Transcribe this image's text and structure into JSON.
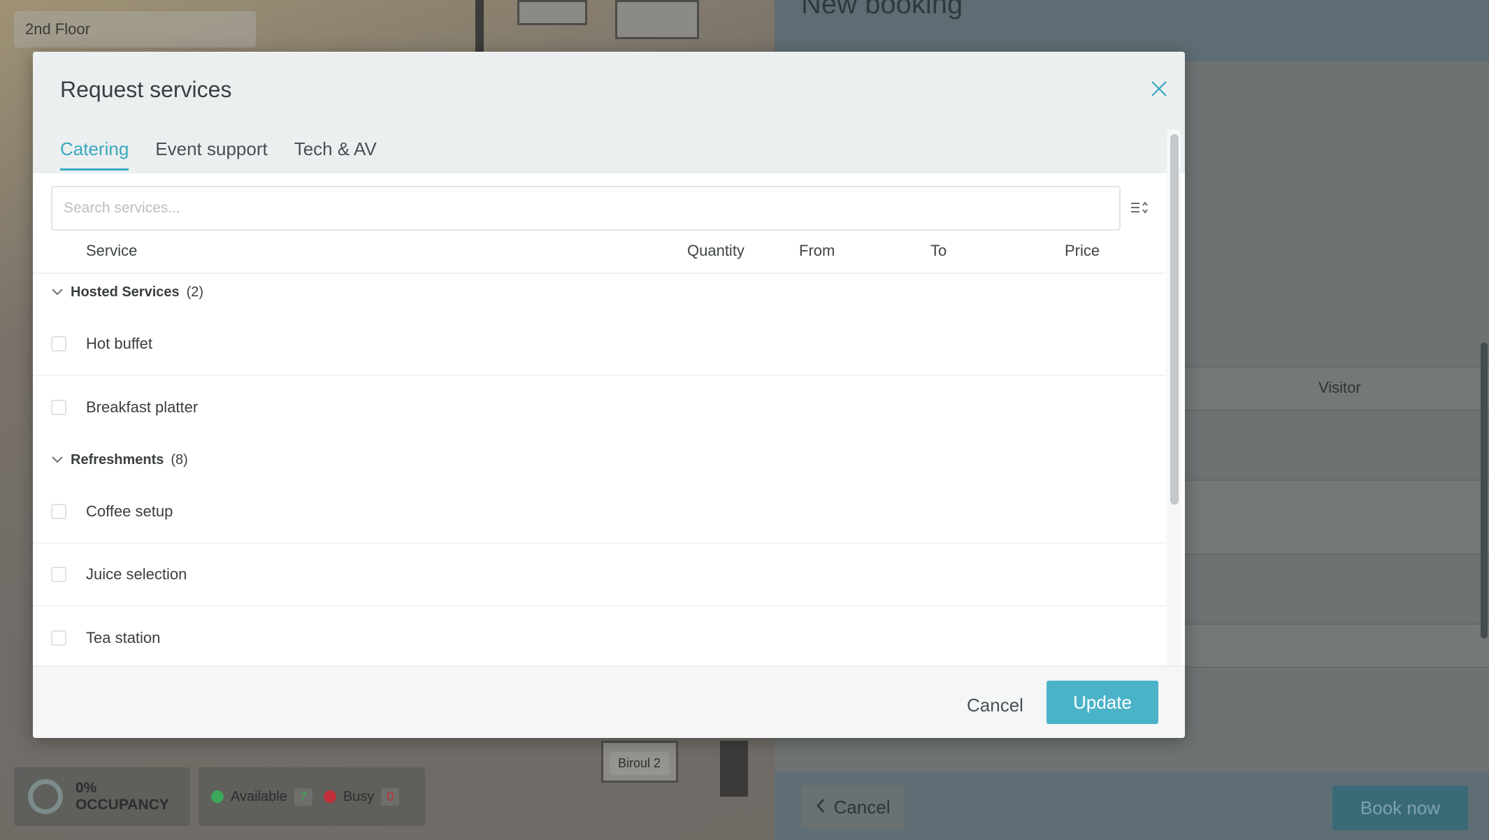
{
  "background": {
    "floor_select": "2nd Floor",
    "floor_tag": "Biroul 2",
    "occupancy": {
      "percent": "0%",
      "label": "OCCUPANCY"
    },
    "status": {
      "available_label": "Available",
      "available_count": "7",
      "busy_label": "Busy",
      "busy_count": "0",
      "available_color": "#3aa857",
      "busy_color": "#c0303a"
    },
    "booking": {
      "title": "New booking",
      "visitor_label": "Visitor",
      "cancel_label": "Cancel",
      "book_label": "Book now"
    }
  },
  "modal": {
    "title": "Request services",
    "tabs": [
      {
        "label": "Catering",
        "active": true
      },
      {
        "label": "Event support",
        "active": false
      },
      {
        "label": "Tech & AV",
        "active": false
      }
    ],
    "search": {
      "placeholder": "Search services...",
      "value": ""
    },
    "columns": {
      "service": "Service",
      "quantity": "Quantity",
      "from": "From",
      "to": "To",
      "price": "Price"
    },
    "groups": [
      {
        "name": "Hosted Services",
        "count": "(2)",
        "items": [
          "Hot buffet",
          "Breakfast platter"
        ]
      },
      {
        "name": "Refreshments",
        "count": "(8)",
        "items": [
          "Coffee setup",
          "Juice selection",
          "Tea station"
        ]
      }
    ],
    "footer": {
      "cancel_label": "Cancel",
      "update_label": "Update"
    },
    "accent_color": "#4bb3c8"
  }
}
